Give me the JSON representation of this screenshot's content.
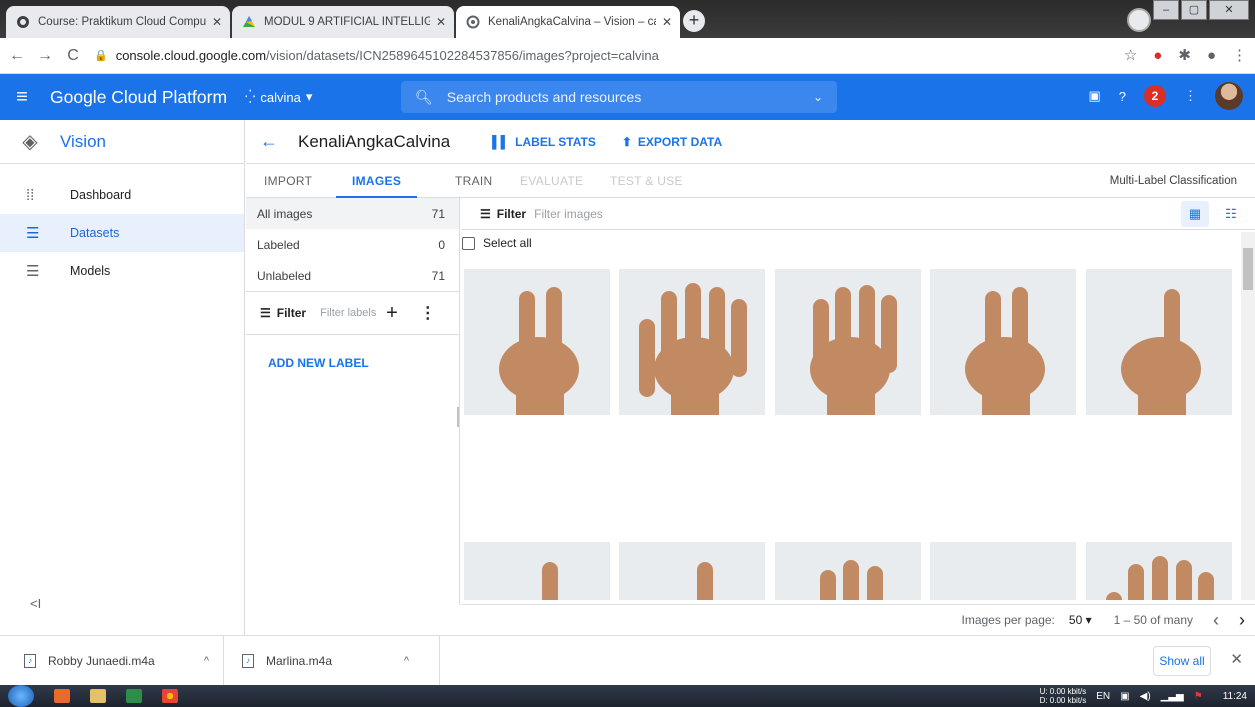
{
  "browser": {
    "tabs": [
      {
        "title": "Course: Praktikum Cloud Compu",
        "icon": "course-icon",
        "active": false
      },
      {
        "title": "MODUL 9 ARTIFICIAL INTELLIGEI",
        "icon": "drive-icon",
        "active": false
      },
      {
        "title": "KenaliAngkaCalvina – Vision – ca",
        "icon": "gcp-icon",
        "active": true
      }
    ],
    "new_tab_label": "+",
    "url_host": "console.cloud.google.com",
    "url_path": "/vision/datasets/ICN2589645102284537856/images?project=calvina"
  },
  "gcp_header": {
    "title": "Google Cloud Platform",
    "project": "calvina",
    "search_placeholder": "Search products and resources",
    "notification_count": "2"
  },
  "sidebar": {
    "product": "Vision",
    "items": [
      {
        "label": "Dashboard",
        "icon": "dashboard-icon",
        "active": false
      },
      {
        "label": "Datasets",
        "icon": "list-icon",
        "active": true
      },
      {
        "label": "Models",
        "icon": "list-icon",
        "active": false
      }
    ],
    "collapse_label": "<I"
  },
  "dataset": {
    "name": "KenaliAngkaCalvina",
    "label_stats": "LABEL STATS",
    "export_data": "EXPORT DATA",
    "tabs": [
      {
        "label": "IMPORT",
        "state": "normal"
      },
      {
        "label": "IMAGES",
        "state": "active"
      },
      {
        "label": "TRAIN",
        "state": "normal"
      },
      {
        "label": "EVALUATE",
        "state": "disabled"
      },
      {
        "label": "TEST & USE",
        "state": "disabled"
      }
    ],
    "classification_type": "Multi-Label Classification"
  },
  "label_panel": {
    "rows": [
      {
        "label": "All images",
        "count": "71"
      },
      {
        "label": "Labeled",
        "count": "0"
      },
      {
        "label": "Unlabeled",
        "count": "71"
      }
    ],
    "filter_label": "Filter",
    "filter_placeholder": "Filter labels",
    "add_new_label": "ADD NEW LABEL"
  },
  "image_grid": {
    "filter_label": "Filter",
    "filter_placeholder": "Filter images",
    "select_all": "Select all",
    "thumbnails": [
      {
        "gesture": "two"
      },
      {
        "gesture": "five"
      },
      {
        "gesture": "four"
      },
      {
        "gesture": "two"
      },
      {
        "gesture": "one"
      },
      {
        "gesture": "one"
      },
      {
        "gesture": "one"
      },
      {
        "gesture": "three"
      },
      {
        "gesture": "fist"
      },
      {
        "gesture": "five"
      }
    ]
  },
  "pager": {
    "images_per_page_label": "Images per page:",
    "images_per_page_value": "50",
    "range": "1 – 50 of many"
  },
  "downloads": {
    "items": [
      {
        "name": "Robby Junaedi.m4a"
      },
      {
        "name": "Marlina.m4a"
      }
    ],
    "show_all": "Show all"
  },
  "taskbar": {
    "net_up": "U:   0.00 kbit/s",
    "net_down": "D:   0.00 kbit/s",
    "lang": "EN",
    "clock": "11:24"
  },
  "colors": {
    "gcp_blue": "#1a73e8",
    "hand_skin": "#c28a63",
    "photo_bg": "#e9ecef"
  }
}
